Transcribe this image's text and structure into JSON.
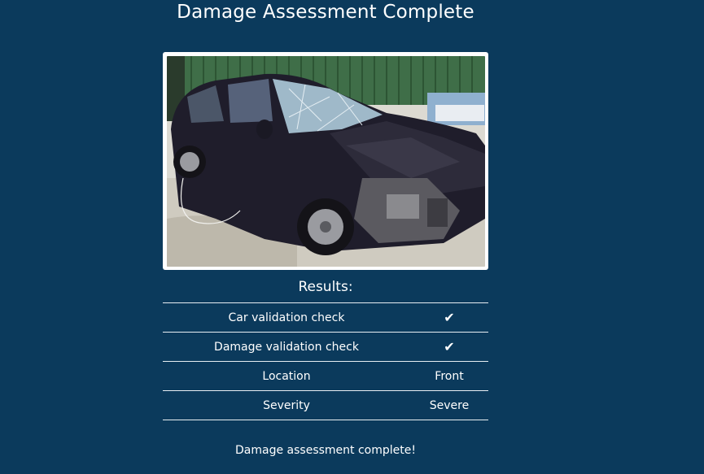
{
  "header": {
    "title": "Damage Assessment Complete"
  },
  "photo": {
    "subject": "damaged dark car, front-end collision"
  },
  "results": {
    "heading": "Results:",
    "rows": [
      {
        "label": "Car validation check",
        "value": "✔",
        "type": "check"
      },
      {
        "label": "Damage validation check",
        "value": "✔",
        "type": "check"
      },
      {
        "label": "Location",
        "value": "Front",
        "type": "text"
      },
      {
        "label": "Severity",
        "value": "Severe",
        "type": "text"
      }
    ]
  },
  "footer": {
    "message": "Damage assessment complete!"
  },
  "colors": {
    "background": "#0b3a5c",
    "text": "#ffffff",
    "divider": "#e8eef3"
  }
}
